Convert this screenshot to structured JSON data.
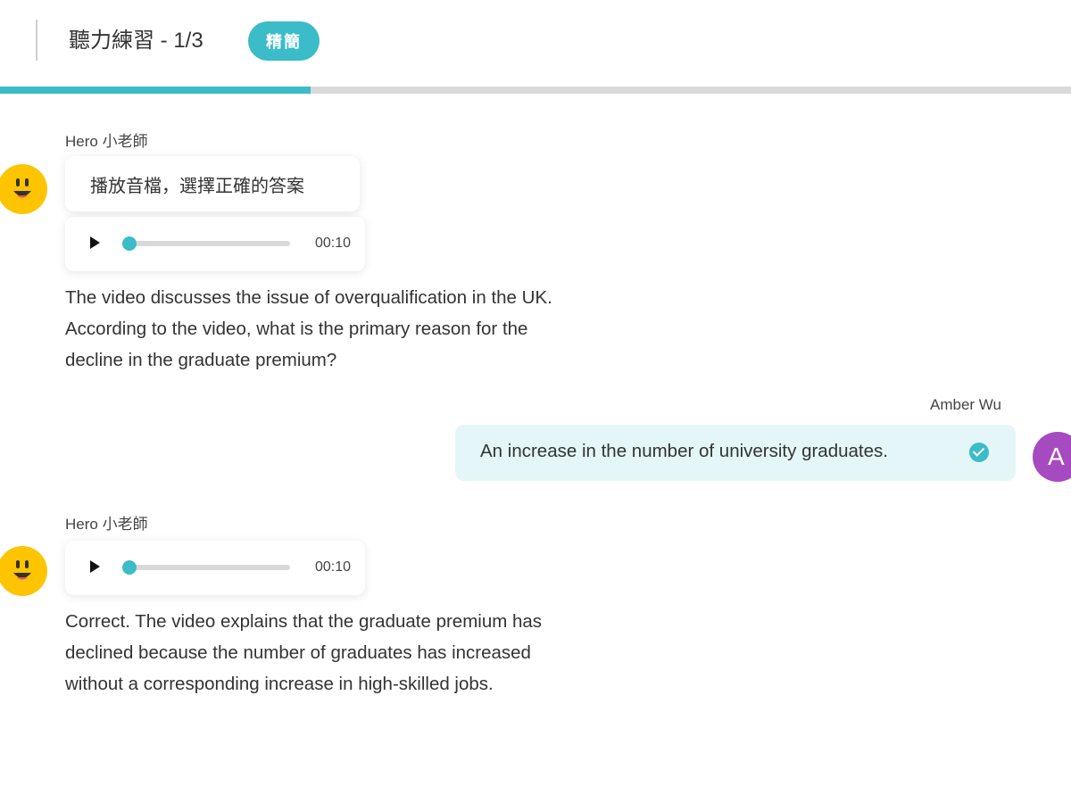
{
  "header": {
    "title": "聽力練習 - 1/3",
    "mode_badge": "精簡",
    "progress_fraction": 0.29,
    "accent_color": "#3bbcc8"
  },
  "messages": {
    "bot1": {
      "sender": "Hero 小老師",
      "avatar_icon": "smiley-face-icon",
      "instruction": "播放音檔，選擇正確的答案",
      "audio": {
        "time": "00:10",
        "position_fraction": 0.0
      },
      "text": "The video discusses the issue of overqualification in the UK. According to the video, what is the primary reason for the decline in the graduate premium?"
    },
    "user": {
      "sender": "Amber Wu",
      "avatar_letter": "A",
      "answer": "An increase in the number of university graduates.",
      "status_icon": "check-circle-icon"
    },
    "bot2": {
      "sender": "Hero 小老師",
      "avatar_icon": "smiley-face-icon",
      "audio": {
        "time": "00:10",
        "position_fraction": 0.0
      },
      "text": "Correct. The video explains that the graduate premium has declined because the number of graduates has increased without a corresponding increase in high-skilled jobs."
    }
  }
}
